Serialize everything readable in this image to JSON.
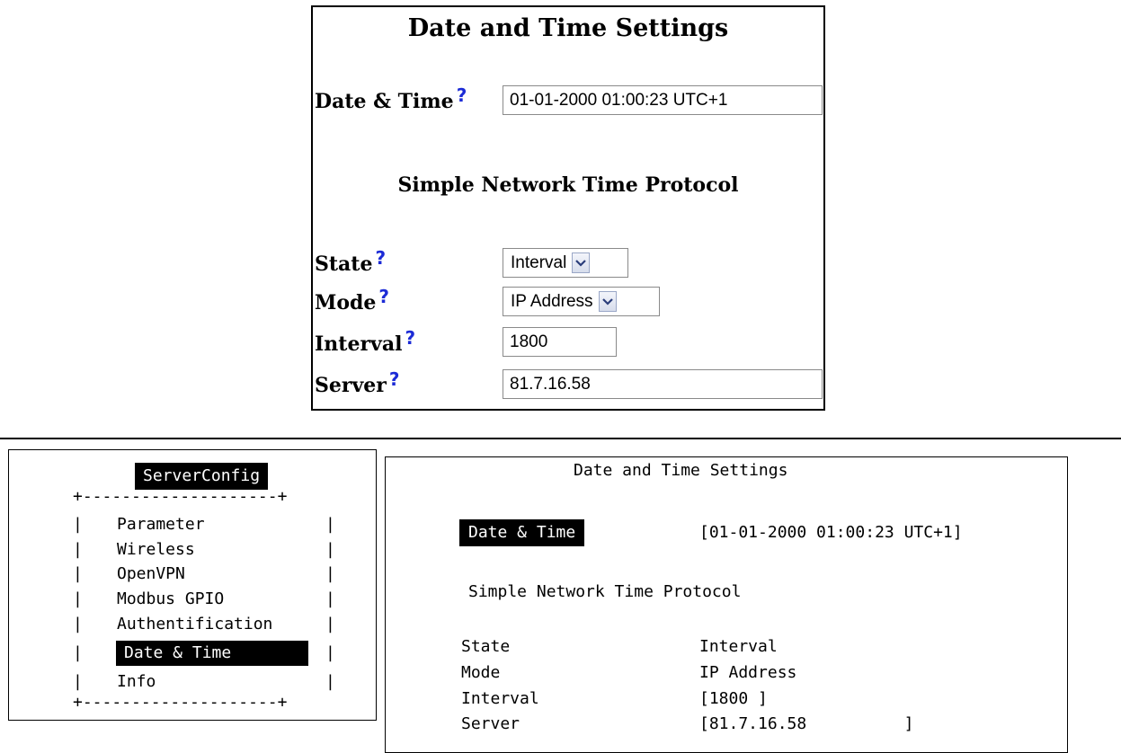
{
  "web_form": {
    "title": "Date and Time Settings",
    "datetime_label": "Date & Time",
    "datetime_value": "01-01-2000 01:00:23 UTC+1",
    "help_glyph": "?",
    "sntp_title": "Simple Network Time Protocol",
    "state_label": "State",
    "state_value": "Interval",
    "mode_label": "Mode",
    "mode_value": "IP Address",
    "interval_label": "Interval",
    "interval_value": "1800",
    "server_label": "Server",
    "server_value": "81.7.16.58",
    "help_color": "#1c2bd6"
  },
  "terminal_menu": {
    "title": "ServerConfig",
    "border_top": "+--------------------+",
    "border_bottom": "+--------------------+",
    "side_left": "|",
    "side_right": "|",
    "items": [
      {
        "label": "Parameter"
      },
      {
        "label": "Wireless"
      },
      {
        "label": "OpenVPN"
      },
      {
        "label": "Modbus GPIO"
      },
      {
        "label": "Authentification"
      },
      {
        "label": "Date & Time",
        "selected": true
      },
      {
        "label": "Info"
      }
    ]
  },
  "terminal_settings": {
    "title": "Date and Time Settings",
    "datetime_label": "Date & Time",
    "datetime_value": "[01-01-2000 01:00:23 UTC+1]",
    "sntp_title": "Simple Network Time Protocol",
    "rows": [
      {
        "label": "State",
        "value": "Interval"
      },
      {
        "label": "Mode",
        "value": "IP Address"
      },
      {
        "label": "Interval",
        "value": "[1800 ]"
      },
      {
        "label": "Server",
        "value": "[81.7.16.58          ]"
      }
    ]
  }
}
